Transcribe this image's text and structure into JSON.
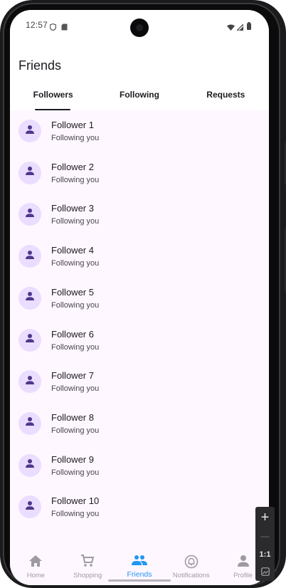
{
  "status_bar": {
    "time": "12:57"
  },
  "app_bar": {
    "title": "Friends"
  },
  "tabs": [
    {
      "label": "Followers",
      "selected": true
    },
    {
      "label": "Following",
      "selected": false
    },
    {
      "label": "Requests",
      "selected": false
    }
  ],
  "followers": [
    {
      "name": "Follower 1",
      "subtitle": "Following you"
    },
    {
      "name": "Follower 2",
      "subtitle": "Following you"
    },
    {
      "name": "Follower 3",
      "subtitle": "Following you"
    },
    {
      "name": "Follower 4",
      "subtitle": "Following you"
    },
    {
      "name": "Follower 5",
      "subtitle": "Following you"
    },
    {
      "name": "Follower 6",
      "subtitle": "Following you"
    },
    {
      "name": "Follower 7",
      "subtitle": "Following you"
    },
    {
      "name": "Follower 8",
      "subtitle": "Following you"
    },
    {
      "name": "Follower 9",
      "subtitle": "Following you"
    },
    {
      "name": "Follower 10",
      "subtitle": "Following you"
    }
  ],
  "bottom_nav": [
    {
      "label": "Home",
      "icon": "home-icon",
      "active": false
    },
    {
      "label": "Shopping",
      "icon": "cart-icon",
      "active": false
    },
    {
      "label": "Friends",
      "icon": "people-icon",
      "active": true
    },
    {
      "label": "Notifications",
      "icon": "bell-icon",
      "active": false
    },
    {
      "label": "Profile",
      "icon": "person-icon",
      "active": false
    }
  ],
  "zoom_controls": {
    "plus": "+",
    "minus": "—",
    "ratio": "1:1"
  },
  "colors": {
    "list_background": "#fef7ff",
    "avatar_background": "#eaddff",
    "avatar_icon": "#4f378b",
    "active_nav": "#2196f3",
    "inactive_nav": "#9e9aa3"
  }
}
